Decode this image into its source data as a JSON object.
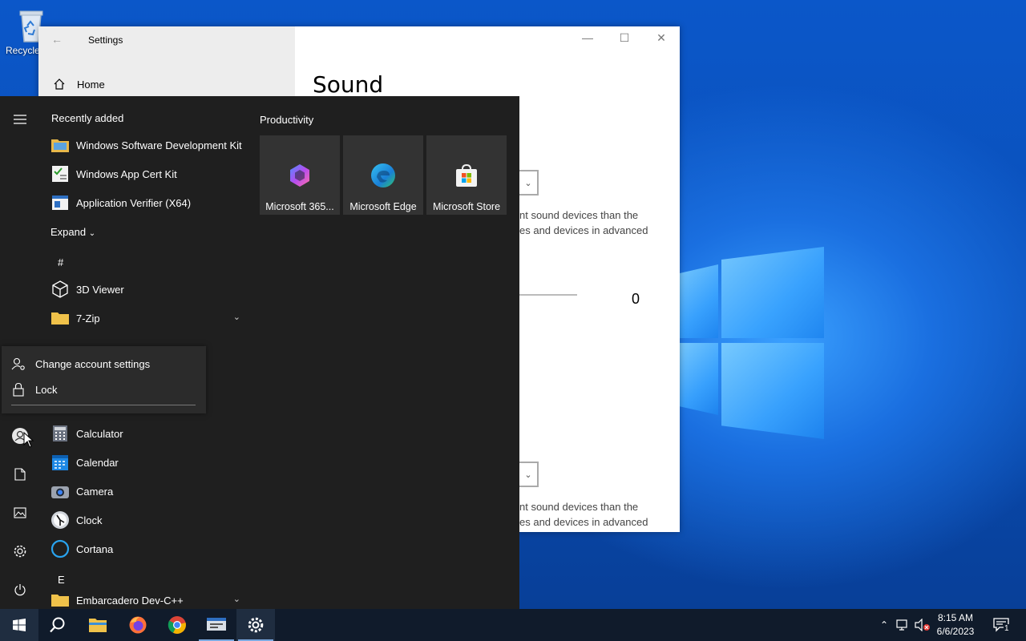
{
  "desktop": {
    "recycle_bin_label": "Recycle"
  },
  "settings_window": {
    "title": "Settings",
    "nav_home": "Home",
    "page_title": "Sound",
    "help_text_1_line1": "nt sound devices than the",
    "help_text_1_line2": "es and devices in advanced",
    "help_text_2_line1": "nt sound devices than the",
    "help_text_2_line2": "es and devices in advanced",
    "volume_value": "0"
  },
  "start_menu": {
    "recently_added_title": "Recently added",
    "recently_added": [
      {
        "label": "Windows Software Development Kit",
        "icon": "sdk-folder-icon"
      },
      {
        "label": "Windows App Cert Kit",
        "icon": "cert-kit-icon"
      },
      {
        "label": "Application Verifier (X64)",
        "icon": "app-verifier-icon"
      }
    ],
    "expand_label": "Expand",
    "letter_hash": "#",
    "letter_e": "E",
    "apps": [
      {
        "label": "3D Viewer",
        "icon": "cube-icon"
      },
      {
        "label": "7-Zip",
        "icon": "folder-icon"
      },
      {
        "label": "Calculator",
        "icon": "calculator-icon"
      },
      {
        "label": "Calendar",
        "icon": "calendar-icon"
      },
      {
        "label": "Camera",
        "icon": "camera-icon"
      },
      {
        "label": "Clock",
        "icon": "clock-icon"
      },
      {
        "label": "Cortana",
        "icon": "cortana-icon"
      },
      {
        "label": "Embarcadero Dev-C++",
        "icon": "folder-icon"
      }
    ],
    "productivity_title": "Productivity",
    "tiles": [
      {
        "label": "Microsoft 365...",
        "icon": "m365-icon"
      },
      {
        "label": "Microsoft Edge",
        "icon": "edge-icon"
      },
      {
        "label": "Microsoft Store",
        "icon": "store-icon"
      }
    ],
    "account_menu": {
      "change_settings": "Change account settings",
      "lock": "Lock"
    }
  },
  "taskbar": {
    "time": "8:15 AM",
    "date": "6/6/2023",
    "notification_count": "1"
  },
  "colors": {
    "start_bg": "#1f1f1f",
    "tile_bg": "#333333",
    "taskbar_bg": "#101b2b",
    "desktop_blue": "#0b57c9"
  }
}
